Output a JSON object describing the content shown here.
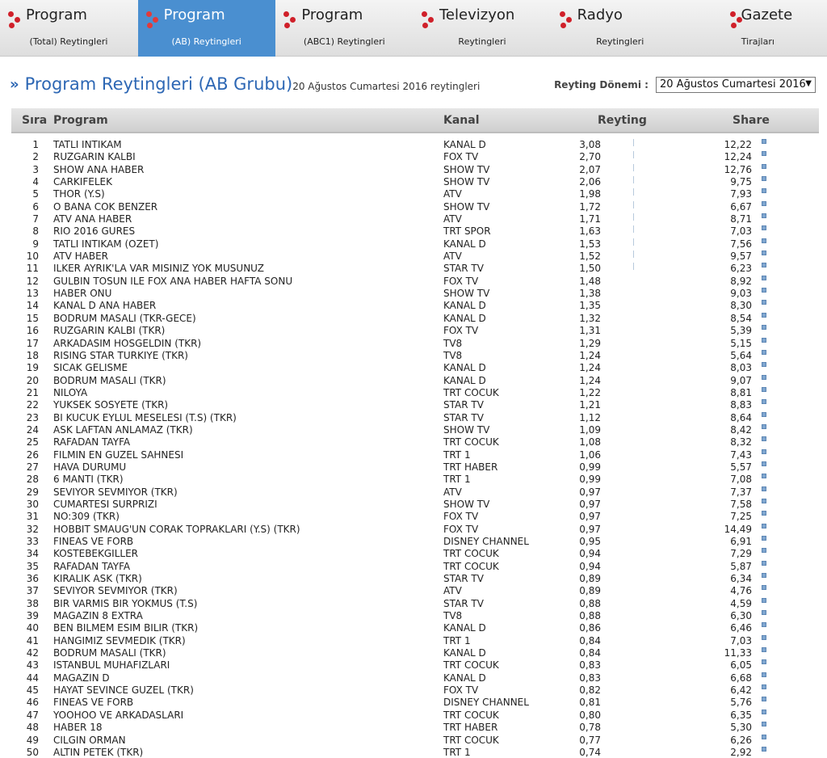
{
  "nav": {
    "tabs": [
      {
        "title": "Program",
        "subtitle": "(Total) Reytingleri",
        "active": false
      },
      {
        "title": "Program",
        "subtitle": "(AB) Reytingleri",
        "active": true
      },
      {
        "title": "Program",
        "subtitle": "(ABC1) Reytingleri",
        "active": false
      },
      {
        "title": "Televizyon",
        "subtitle": "Reytingleri",
        "active": false
      },
      {
        "title": "Radyo",
        "subtitle": "Reytingleri",
        "active": false
      },
      {
        "title": "Gazete",
        "subtitle": "Tirajları",
        "active": false
      }
    ]
  },
  "heading": {
    "arrows": "»",
    "title": "Program Reytingleri (AB Grubu)",
    "subtitle": "20 Ağustos Cumartesi 2016 reytingleri"
  },
  "period": {
    "label": "Reyting Dönemi :",
    "selected": "20 Ağustos Cumartesi 2016",
    "caret": "▼"
  },
  "table": {
    "headers": {
      "sira": "Sıra",
      "program": "Program",
      "kanal": "Kanal",
      "reyting": "Reyting",
      "share": "Share"
    },
    "rows": [
      {
        "sira": "1",
        "program": "TATLI INTIKAM",
        "kanal": "KANAL D",
        "reyting": "3,08",
        "share": "12,22"
      },
      {
        "sira": "2",
        "program": "RUZGARIN KALBI",
        "kanal": "FOX TV",
        "reyting": "2,70",
        "share": "12,24"
      },
      {
        "sira": "3",
        "program": "SHOW ANA HABER",
        "kanal": "SHOW TV",
        "reyting": "2,07",
        "share": "12,76"
      },
      {
        "sira": "4",
        "program": "CARKIFELEK",
        "kanal": "SHOW TV",
        "reyting": "2,06",
        "share": "9,75"
      },
      {
        "sira": "5",
        "program": "THOR (Y.S)",
        "kanal": "ATV",
        "reyting": "1,98",
        "share": "7,93"
      },
      {
        "sira": "6",
        "program": "O BANA COK BENZER",
        "kanal": "SHOW TV",
        "reyting": "1,72",
        "share": "6,67"
      },
      {
        "sira": "7",
        "program": "ATV ANA HABER",
        "kanal": "ATV",
        "reyting": "1,71",
        "share": "8,71"
      },
      {
        "sira": "8",
        "program": "RIO 2016 GURES",
        "kanal": "TRT SPOR",
        "reyting": "1,63",
        "share": "7,03"
      },
      {
        "sira": "9",
        "program": "TATLI INTIKAM (OZET)",
        "kanal": "KANAL D",
        "reyting": "1,53",
        "share": "7,56"
      },
      {
        "sira": "10",
        "program": "ATV HABER",
        "kanal": "ATV",
        "reyting": "1,52",
        "share": "9,57"
      },
      {
        "sira": "11",
        "program": "ILKER AYRIK'LA VAR MISINIZ YOK MUSUNUZ",
        "kanal": "STAR TV",
        "reyting": "1,50",
        "share": "6,23"
      },
      {
        "sira": "12",
        "program": "GULBIN TOSUN ILE FOX ANA HABER HAFTA SONU",
        "kanal": "FOX TV",
        "reyting": "1,48",
        "share": "8,92"
      },
      {
        "sira": "13",
        "program": "HABER ONU",
        "kanal": "SHOW TV",
        "reyting": "1,38",
        "share": "9,03"
      },
      {
        "sira": "14",
        "program": "KANAL D ANA HABER",
        "kanal": "KANAL D",
        "reyting": "1,35",
        "share": "8,30"
      },
      {
        "sira": "15",
        "program": "BODRUM MASALI (TKR-GECE)",
        "kanal": "KANAL D",
        "reyting": "1,32",
        "share": "8,54"
      },
      {
        "sira": "16",
        "program": "RUZGARIN KALBI (TKR)",
        "kanal": "FOX TV",
        "reyting": "1,31",
        "share": "5,39"
      },
      {
        "sira": "17",
        "program": "ARKADASIM HOSGELDIN (TKR)",
        "kanal": "TV8",
        "reyting": "1,29",
        "share": "5,15"
      },
      {
        "sira": "18",
        "program": "RISING STAR TURKIYE (TKR)",
        "kanal": "TV8",
        "reyting": "1,24",
        "share": "5,64"
      },
      {
        "sira": "19",
        "program": "SICAK GELISME",
        "kanal": "KANAL D",
        "reyting": "1,24",
        "share": "8,03"
      },
      {
        "sira": "20",
        "program": "BODRUM MASALI (TKR)",
        "kanal": "KANAL D",
        "reyting": "1,24",
        "share": "9,07"
      },
      {
        "sira": "21",
        "program": "NILOYA",
        "kanal": "TRT COCUK",
        "reyting": "1,22",
        "share": "8,81"
      },
      {
        "sira": "22",
        "program": "YUKSEK SOSYETE (TKR)",
        "kanal": "STAR TV",
        "reyting": "1,21",
        "share": "8,83"
      },
      {
        "sira": "23",
        "program": "BI KUCUK EYLUL MESELESI (T.S) (TKR)",
        "kanal": "STAR TV",
        "reyting": "1,12",
        "share": "8,64"
      },
      {
        "sira": "24",
        "program": "ASK LAFTAN ANLAMAZ (TKR)",
        "kanal": "SHOW TV",
        "reyting": "1,09",
        "share": "8,42"
      },
      {
        "sira": "25",
        "program": "RAFADAN TAYFA",
        "kanal": "TRT COCUK",
        "reyting": "1,08",
        "share": "8,32"
      },
      {
        "sira": "26",
        "program": "FILMIN EN GUZEL SAHNESI",
        "kanal": "TRT 1",
        "reyting": "1,06",
        "share": "7,43"
      },
      {
        "sira": "27",
        "program": "HAVA DURUMU",
        "kanal": "TRT HABER",
        "reyting": "0,99",
        "share": "5,57"
      },
      {
        "sira": "28",
        "program": "6 MANTI (TKR)",
        "kanal": "TRT 1",
        "reyting": "0,99",
        "share": "7,08"
      },
      {
        "sira": "29",
        "program": "SEVIYOR SEVMIYOR (TKR)",
        "kanal": "ATV",
        "reyting": "0,97",
        "share": "7,37"
      },
      {
        "sira": "30",
        "program": "CUMARTESI SURPRIZI",
        "kanal": "SHOW TV",
        "reyting": "0,97",
        "share": "7,58"
      },
      {
        "sira": "31",
        "program": "NO:309 (TKR)",
        "kanal": "FOX TV",
        "reyting": "0,97",
        "share": "7,25"
      },
      {
        "sira": "32",
        "program": "HOBBIT SMAUG'UN CORAK TOPRAKLARI (Y.S) (TKR)",
        "kanal": "FOX TV",
        "reyting": "0,97",
        "share": "14,49"
      },
      {
        "sira": "33",
        "program": "FINEAS VE FORB",
        "kanal": "DISNEY CHANNEL",
        "reyting": "0,95",
        "share": "6,91"
      },
      {
        "sira": "34",
        "program": "KOSTEBEKGILLER",
        "kanal": "TRT COCUK",
        "reyting": "0,94",
        "share": "7,29"
      },
      {
        "sira": "35",
        "program": "RAFADAN TAYFA",
        "kanal": "TRT COCUK",
        "reyting": "0,94",
        "share": "5,87"
      },
      {
        "sira": "36",
        "program": "KIRALIK ASK (TKR)",
        "kanal": "STAR TV",
        "reyting": "0,89",
        "share": "6,34"
      },
      {
        "sira": "37",
        "program": "SEVIYOR SEVMIYOR (TKR)",
        "kanal": "ATV",
        "reyting": "0,89",
        "share": "4,76"
      },
      {
        "sira": "38",
        "program": "BIR VARMIS BIR YOKMUS (T.S)",
        "kanal": "STAR TV",
        "reyting": "0,88",
        "share": "4,59"
      },
      {
        "sira": "39",
        "program": "MAGAZIN 8 EXTRA",
        "kanal": "TV8",
        "reyting": "0,88",
        "share": "6,30"
      },
      {
        "sira": "40",
        "program": "BEN BILMEM ESIM BILIR (TKR)",
        "kanal": "KANAL D",
        "reyting": "0,86",
        "share": "6,46"
      },
      {
        "sira": "41",
        "program": "HANGIMIZ SEVMEDIK (TKR)",
        "kanal": "TRT 1",
        "reyting": "0,84",
        "share": "7,03"
      },
      {
        "sira": "42",
        "program": "BODRUM MASALI (TKR)",
        "kanal": "KANAL D",
        "reyting": "0,84",
        "share": "11,33"
      },
      {
        "sira": "43",
        "program": "ISTANBUL MUHAFIZLARI",
        "kanal": "TRT COCUK",
        "reyting": "0,83",
        "share": "6,05"
      },
      {
        "sira": "44",
        "program": "MAGAZIN D",
        "kanal": "KANAL D",
        "reyting": "0,83",
        "share": "6,68"
      },
      {
        "sira": "45",
        "program": "HAYAT SEVINCE GUZEL (TKR)",
        "kanal": "FOX TV",
        "reyting": "0,82",
        "share": "6,42"
      },
      {
        "sira": "46",
        "program": "FINEAS VE FORB",
        "kanal": "DISNEY CHANNEL",
        "reyting": "0,81",
        "share": "5,76"
      },
      {
        "sira": "47",
        "program": "YOOHOO VE ARKADASLARI",
        "kanal": "TRT COCUK",
        "reyting": "0,80",
        "share": "6,35"
      },
      {
        "sira": "48",
        "program": "HABER 18",
        "kanal": "TRT HABER",
        "reyting": "0,78",
        "share": "5,30"
      },
      {
        "sira": "49",
        "program": "CILGIN ORMAN",
        "kanal": "TRT COCUK",
        "reyting": "0,77",
        "share": "6,26"
      },
      {
        "sira": "50",
        "program": "ALTIN PETEK (TKR)",
        "kanal": "TRT 1",
        "reyting": "0,74",
        "share": "2,92"
      }
    ]
  }
}
